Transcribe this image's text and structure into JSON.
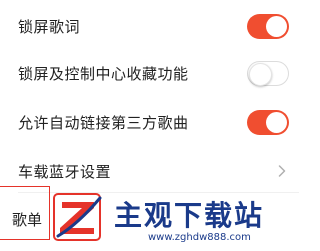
{
  "settings": {
    "items": [
      {
        "label": "锁屏歌词",
        "control": "toggle",
        "state": "on"
      },
      {
        "label": "锁屏及控制中心收藏功能",
        "control": "toggle",
        "state": "off"
      },
      {
        "label": "允许自动链接第三方歌曲",
        "control": "toggle",
        "state": "on"
      },
      {
        "label": "车载蓝牙设置",
        "control": "chevron"
      }
    ],
    "partial_item_label": "歌单"
  },
  "watermark": {
    "title": "主观下载站",
    "url": "www.zghdw888.com"
  },
  "colors": {
    "toggle_on": "#f04e30",
    "toggle_off_border": "#dcdcdc",
    "watermark_blue": "#1a3a8a",
    "watermark_red": "#e5332a"
  }
}
